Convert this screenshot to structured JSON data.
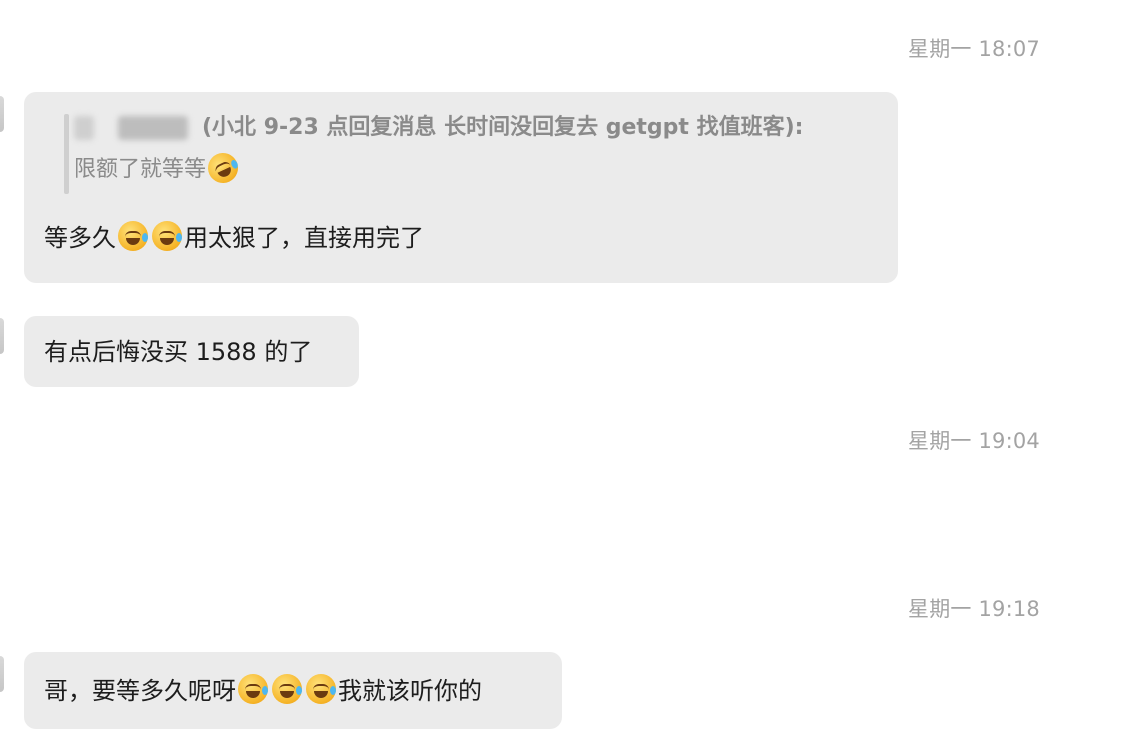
{
  "timestamps": {
    "t1": "星期一 18:07",
    "t2": "星期一 19:04",
    "t3": "星期一 19:18"
  },
  "messages": {
    "m1": {
      "quote_header": "(小北 9-23 点回复消息 长时间没回复去 getgpt 找值班客):",
      "quote_body": "限额了就等等",
      "quote_emoji": "rolling-on-floor-laughing",
      "text_before": "等多久",
      "emoji": "face-with-tears-of-joy",
      "text_after": "用太狠了，直接用完了"
    },
    "m2": {
      "text": "有点后悔没买 1588 的了"
    },
    "m3": {
      "text_before": "哥，要等多久呢呀",
      "emoji": "face-with-tears-of-joy",
      "text_after": "我就该听你的"
    }
  }
}
